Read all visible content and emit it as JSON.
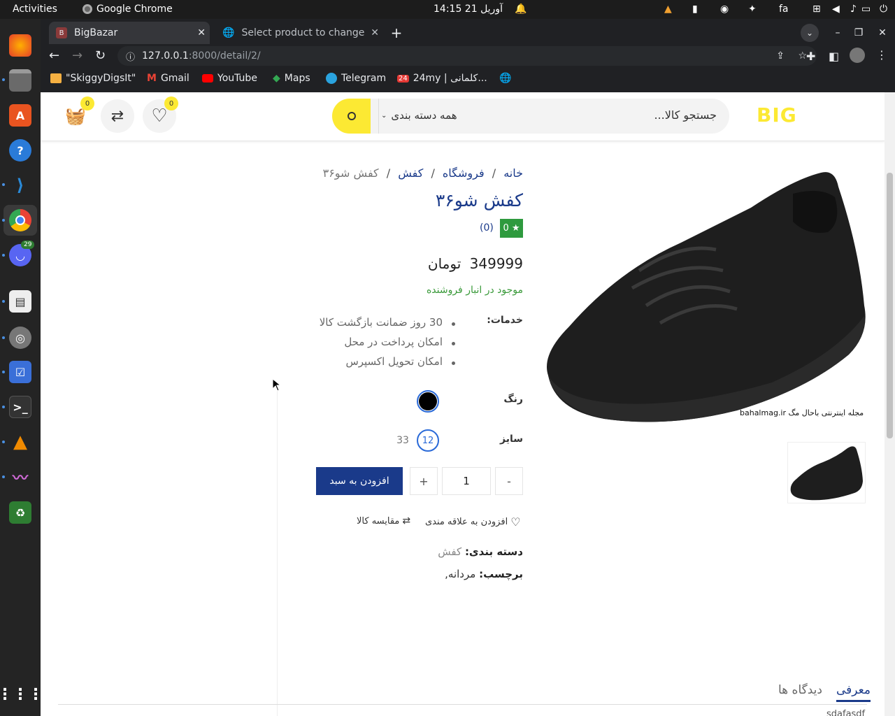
{
  "os": {
    "activities": "Activities",
    "app_name": "Google Chrome",
    "clock": "14:15  21 آوریل",
    "lang": "fa",
    "dock_badge": "29"
  },
  "browser": {
    "tabs": [
      {
        "favicon": "B",
        "title": "BigBazar"
      },
      {
        "title": "Select product to change"
      }
    ],
    "url_host": "127.0.0.1",
    "url_rest": ":8000/detail/2/",
    "bookmarks": [
      "\"SkiggyDigsIt\"",
      "Gmail",
      "YouTube",
      "Maps",
      "Telegram",
      "24my | کلمانی..."
    ]
  },
  "site": {
    "logo": "BIG",
    "search_placeholder": "جستجو کالا...",
    "category_select": "همه دسته بندی",
    "wishlist_count": "0",
    "cart_count": "0"
  },
  "product": {
    "breadcrumb": [
      "خانه",
      "فروشگاه",
      "کفش",
      "کفش شو۳۶"
    ],
    "title": "کفش شو۳۶",
    "rating": "0 ★",
    "reviews": "(0)",
    "price": "349999",
    "currency": "تومان",
    "stock": "موجود در انبار فروشنده",
    "services_label": "خدمات:",
    "services": [
      "30 روز ضمانت بازگشت کالا",
      "امکان پرداخت در محل",
      "امکان تحویل اکسپرس"
    ],
    "color_label": "رنگ",
    "selected_color": "#000000",
    "size_label": "سایز",
    "sizes": [
      "12",
      "33"
    ],
    "qty": "1",
    "minus": "-",
    "plus": "+",
    "add_to_cart": "افزودن به سبد",
    "wishlist_link": "افزودن به علاقه مندی",
    "compare_link": "مقایسه کالا",
    "category_label": "دسته بندی:",
    "category_value": "کفش",
    "tag_label": "برچسب:",
    "tag_value": "مردانه,",
    "image_caption": "مجله اینترنتی باحال مگ bahalmag.ir"
  },
  "tabs_bottom": {
    "intro": "معرفی",
    "reviews": "دیدگاه ها",
    "content": "sdafasdf"
  },
  "colors": {
    "accent_yellow": "#fce933",
    "primary_blue": "#1a3a8a",
    "stock_green": "#3a9a3a"
  }
}
